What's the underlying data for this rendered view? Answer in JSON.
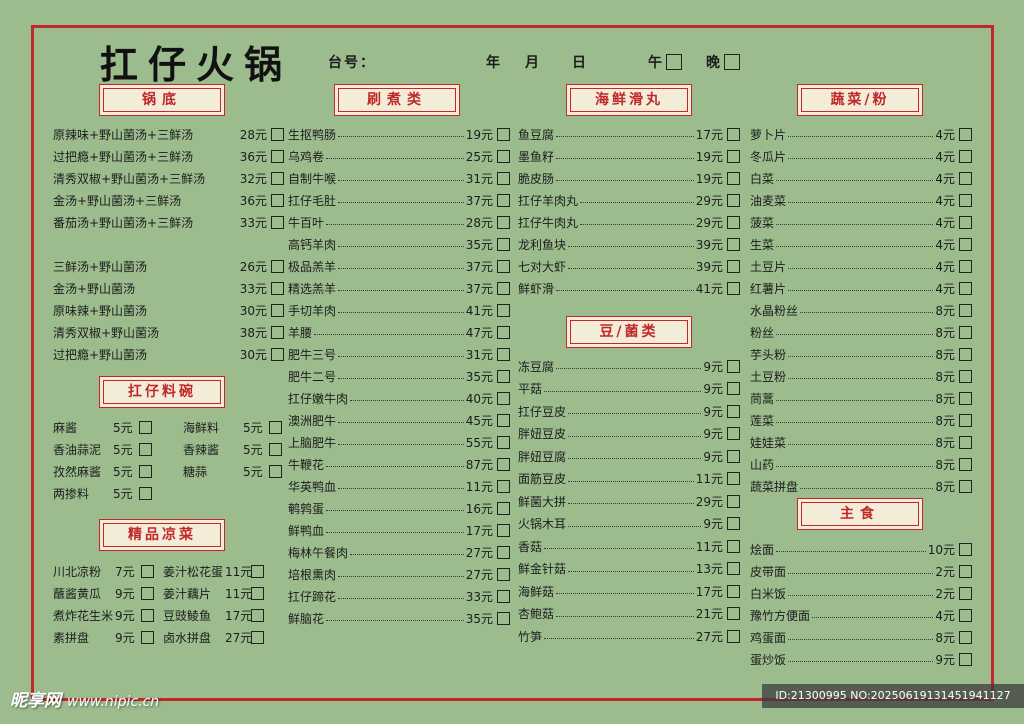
{
  "header": {
    "title": "扛仔火锅",
    "table_no_label": "台号：",
    "year_label": "年",
    "month_label": "月",
    "day_label": "日",
    "noon_label": "午",
    "evening_label": "晚"
  },
  "sections": {
    "guodi": "锅底",
    "shuazhu": "刷煮类",
    "haixian": "海鲜滑丸",
    "shucai": "蔬菜/粉",
    "liaowan": "扛仔料碗",
    "liangcai": "精品凉菜",
    "doujun": "豆/菌类",
    "zhushi": "主食"
  },
  "guodi_items": [
    {
      "name": "原辣味+野山菌汤+三鲜汤",
      "price": "28元"
    },
    {
      "name": "过把瘾+野山菌汤+三鲜汤",
      "price": "36元"
    },
    {
      "name": "清秀双椒+野山菌汤+三鲜汤",
      "price": "32元"
    },
    {
      "name": "金汤+野山菌汤+三鲜汤",
      "price": "36元"
    },
    {
      "name": "番茄汤+野山菌汤+三鲜汤",
      "price": "33元"
    },
    {
      "name": "三鲜汤+野山菌汤",
      "price": "26元"
    },
    {
      "name": "金汤+野山菌汤",
      "price": "33元"
    },
    {
      "name": "原味辣+野山菌汤",
      "price": "30元"
    },
    {
      "name": "清秀双椒+野山菌汤",
      "price": "38元"
    },
    {
      "name": "过把瘾+野山菌汤",
      "price": "30元"
    }
  ],
  "liaowan_items": [
    {
      "name": "麻酱",
      "price": "5元"
    },
    {
      "name": "海鲜料",
      "price": "5元"
    },
    {
      "name": "香油蒜泥",
      "price": "5元"
    },
    {
      "name": "香辣酱",
      "price": "5元"
    },
    {
      "name": "孜然麻酱",
      "price": "5元"
    },
    {
      "name": "糖蒜",
      "price": "5元"
    },
    {
      "name": "两掺料",
      "price": "5元"
    }
  ],
  "liangcai_items": [
    {
      "name": "川北凉粉",
      "price": "7元"
    },
    {
      "name": "姜汁松花蛋",
      "price": "11元"
    },
    {
      "name": "蘸酱黄瓜",
      "price": "9元"
    },
    {
      "name": "姜汁藕片",
      "price": "11元"
    },
    {
      "name": "煮炸花生米",
      "price": "9元"
    },
    {
      "name": "豆豉鲮鱼",
      "price": "17元"
    },
    {
      "name": "素拼盘",
      "price": "9元"
    },
    {
      "name": "卤水拼盘",
      "price": "27元"
    }
  ],
  "shuazhu_items": [
    {
      "name": "生抠鸭肠",
      "price": "19元"
    },
    {
      "name": "乌鸡卷",
      "price": "25元"
    },
    {
      "name": "自制牛喉",
      "price": "31元"
    },
    {
      "name": "扛仔毛肚",
      "price": "37元"
    },
    {
      "name": "牛百叶",
      "price": "28元"
    },
    {
      "name": "高钙羊肉",
      "price": "35元"
    },
    {
      "name": "极品羔羊",
      "price": "37元"
    },
    {
      "name": "精选羔羊",
      "price": "37元"
    },
    {
      "name": "手切羊肉",
      "price": "41元"
    },
    {
      "name": "羊腰",
      "price": "47元"
    },
    {
      "name": "肥牛三号",
      "price": "31元"
    },
    {
      "name": "肥牛二号",
      "price": "35元"
    },
    {
      "name": "扛仔嫩牛肉",
      "price": "40元"
    },
    {
      "name": "澳洲肥牛",
      "price": "45元"
    },
    {
      "name": "上脑肥牛",
      "price": "55元"
    },
    {
      "name": "牛鞭花",
      "price": "87元"
    },
    {
      "name": "华英鸭血",
      "price": "11元"
    },
    {
      "name": "鹌鹑蛋",
      "price": "16元"
    },
    {
      "name": "鲜鸭血",
      "price": "17元"
    },
    {
      "name": "梅林午餐肉",
      "price": "27元"
    },
    {
      "name": "培根熏肉",
      "price": "27元"
    },
    {
      "name": "扛仔蹄花",
      "price": "33元"
    },
    {
      "name": "鲜脑花",
      "price": "35元"
    }
  ],
  "haixian_items": [
    {
      "name": "鱼豆腐",
      "price": "17元"
    },
    {
      "name": "墨鱼籽",
      "price": "19元"
    },
    {
      "name": "脆皮肠",
      "price": "19元"
    },
    {
      "name": "扛仔羊肉丸",
      "price": "29元"
    },
    {
      "name": "扛仔牛肉丸",
      "price": "29元"
    },
    {
      "name": "龙利鱼块",
      "price": "39元"
    },
    {
      "name": "七对大虾",
      "price": "39元"
    },
    {
      "name": "鲜虾滑",
      "price": "41元"
    }
  ],
  "doujun_items": [
    {
      "name": "冻豆腐",
      "price": "9元"
    },
    {
      "name": "平菇",
      "price": "9元"
    },
    {
      "name": "扛仔豆皮",
      "price": "9元"
    },
    {
      "name": "胖妞豆皮",
      "price": "9元"
    },
    {
      "name": "胖妞豆腐",
      "price": "9元"
    },
    {
      "name": "面筋豆皮",
      "price": "11元"
    },
    {
      "name": "鲜菌大拼",
      "price": "29元"
    },
    {
      "name": "火锅木耳",
      "price": "9元"
    },
    {
      "name": "香菇",
      "price": "11元"
    },
    {
      "name": "鲜金针菇",
      "price": "13元"
    },
    {
      "name": "海鲜菇",
      "price": "17元"
    },
    {
      "name": "杏鲍菇",
      "price": "21元"
    },
    {
      "name": "竹笋",
      "price": "27元"
    }
  ],
  "shucai_items": [
    {
      "name": "萝卜片",
      "price": "4元"
    },
    {
      "name": "冬瓜片",
      "price": "4元"
    },
    {
      "name": "白菜",
      "price": "4元"
    },
    {
      "name": "油麦菜",
      "price": "4元"
    },
    {
      "name": "菠菜",
      "price": "4元"
    },
    {
      "name": "生菜",
      "price": "4元"
    },
    {
      "name": "土豆片",
      "price": "4元"
    },
    {
      "name": "红薯片",
      "price": "4元"
    },
    {
      "name": "水晶粉丝",
      "price": "8元"
    },
    {
      "name": "粉丝",
      "price": "8元"
    },
    {
      "name": "芋头粉",
      "price": "8元"
    },
    {
      "name": "土豆粉",
      "price": "8元"
    },
    {
      "name": "茼蒿",
      "price": "8元"
    },
    {
      "name": "莲菜",
      "price": "8元"
    },
    {
      "name": "娃娃菜",
      "price": "8元"
    },
    {
      "name": "山药",
      "price": "8元"
    },
    {
      "name": "蔬菜拼盘",
      "price": "8元"
    }
  ],
  "zhushi_items": [
    {
      "name": "烩面",
      "price": "10元"
    },
    {
      "name": "皮带面",
      "price": "2元"
    },
    {
      "name": "白米饭",
      "price": "2元"
    },
    {
      "name": "豫竹方便面",
      "price": "4元"
    },
    {
      "name": "鸡蛋面",
      "price": "8元"
    },
    {
      "name": "蛋炒饭",
      "price": "9元"
    }
  ],
  "watermark": {
    "left_logo": "昵享网",
    "left_url": "www.nipic.cn",
    "right_id": "ID:21300995 NO:20250619131451941127"
  }
}
